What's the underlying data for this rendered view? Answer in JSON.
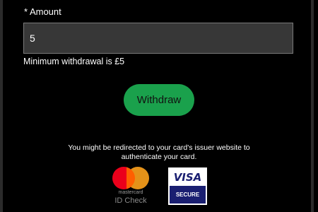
{
  "form": {
    "amount_label": "* Amount",
    "amount_value": "5",
    "min_hint": "Minimum withdrawal is £5",
    "submit_label": "Withdraw"
  },
  "footer": {
    "redirect_note": "You might be redirected to your card's issuer website to authenticate your card."
  },
  "badges": {
    "mastercard_word": "mastercard",
    "mastercard_check": "ID Check",
    "visa_word": "VISA",
    "visa_secure": "SECURE"
  },
  "colors": {
    "background": "#000000",
    "input_background": "#373737",
    "button_green": "#1aa14c",
    "visa_blue": "#1a1f71",
    "mastercard_red": "#eb001b",
    "mastercard_yellow": "#f79e1b"
  },
  "icons": [
    "mastercard-id-check-icon",
    "visa-secure-icon"
  ]
}
